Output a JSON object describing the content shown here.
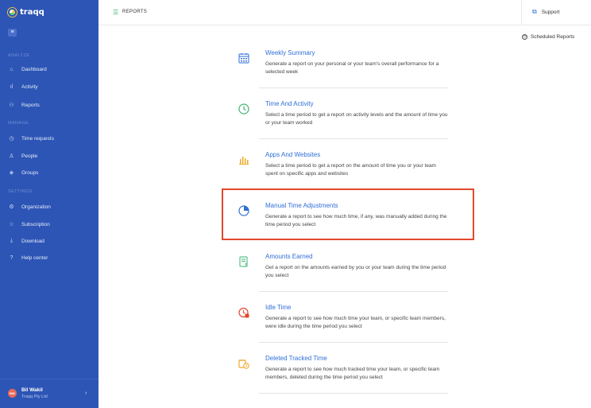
{
  "app": {
    "name": "traqq"
  },
  "sidebar": {
    "sections": [
      {
        "title": "ANALYZE",
        "items": [
          {
            "label": "Dashboard",
            "icon": "home-icon"
          },
          {
            "label": "Activity",
            "icon": "bar-chart-icon"
          },
          {
            "label": "Reports",
            "icon": "reports-icon"
          }
        ]
      },
      {
        "title": "MANAGE",
        "items": [
          {
            "label": "Time requests",
            "icon": "clock-icon"
          },
          {
            "label": "People",
            "icon": "people-icon"
          },
          {
            "label": "Groups",
            "icon": "groups-icon"
          }
        ]
      },
      {
        "title": "SETTINGS",
        "items": [
          {
            "label": "Organization",
            "icon": "gear-icon"
          },
          {
            "label": "Subscription",
            "icon": "star-icon"
          },
          {
            "label": "Download",
            "icon": "download-icon"
          },
          {
            "label": "Help center",
            "icon": "help-icon"
          }
        ]
      }
    ],
    "user": {
      "initials": "BW",
      "name": "Bil Wakil",
      "org": "Traqq Pty Ltd"
    }
  },
  "header": {
    "title": "REPORTS",
    "support_label": "Support"
  },
  "scheduled_label": "Scheduled Reports",
  "reports": [
    {
      "title": "Weekly Summary",
      "desc": "Generate a report on your personal or your team's overall performance for a selected week",
      "icon": "calendar-icon",
      "color": "#2f6fd8"
    },
    {
      "title": "Time And Activity",
      "desc": "Select a time period to get a report on activity levels and the amount of time you or your team worked",
      "icon": "clock-icon",
      "color": "#3cb371"
    },
    {
      "title": "Apps And Websites",
      "desc": "Select a time period to get a report on the amount of time you or your team spent on specific apps and websites",
      "icon": "bar-chart-icon",
      "color": "#f0a92b"
    },
    {
      "title": "Manual Time Adjustments",
      "desc": "Generate a report to see how much time, if any, was manually added during the time period you select",
      "icon": "pie-chart-icon",
      "color": "#2f6fd8"
    },
    {
      "title": "Amounts Earned",
      "desc": "Get a report on the amounts earned by you or your team during the time period you select",
      "icon": "invoice-icon",
      "color": "#3cb371"
    },
    {
      "title": "Idle Time",
      "desc": "Generate a report to see how much time your team, or specific team members, were idle during the time period you select",
      "icon": "idle-clock-icon",
      "color": "#e3472d"
    },
    {
      "title": "Deleted Tracked Time",
      "desc": "Generate a report to see how much tracked time your team, or specific team members, deleted during the time period you select",
      "icon": "deleted-time-icon",
      "color": "#f0a92b"
    }
  ]
}
